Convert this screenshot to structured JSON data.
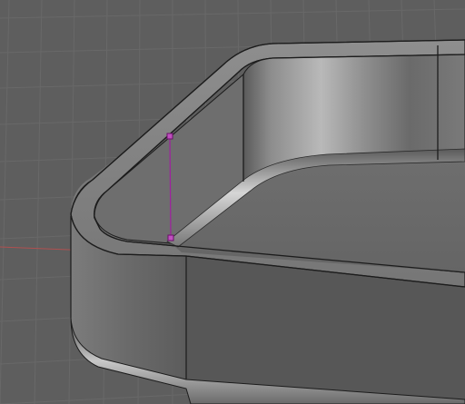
{
  "viewport": {
    "background_color": "#5e5e5e",
    "grid_color": "#6e6e6e",
    "x_axis_color": "#b05050",
    "selection_color": "#a020a0"
  },
  "model": {
    "type": "rounded-rectangular-tray",
    "body_color": "#6a6a6a",
    "edge_color": "#1c1c1c",
    "highlight_color": "#d0d0d0"
  },
  "selection": {
    "type": "sketch-line",
    "endpoints": 2
  }
}
